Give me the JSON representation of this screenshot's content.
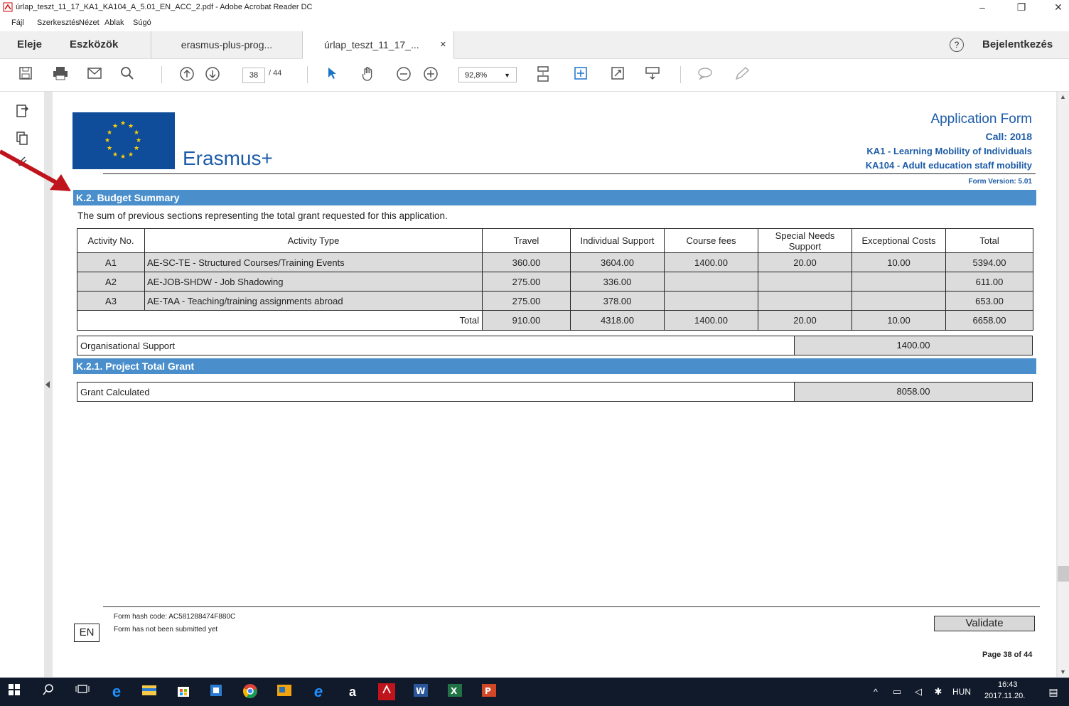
{
  "window": {
    "title": "úrlap_teszt_11_17_KA1_KA104_A_5.01_EN_ACC_2.pdf - Adobe Acrobat Reader DC",
    "minimize": "–",
    "restore": "❐",
    "close": "✕"
  },
  "menu": [
    "Fájl",
    "Szerkesztés",
    "Nézet",
    "Ablak",
    "Súgó"
  ],
  "tabs": {
    "home": "Eleje",
    "tools": "Eszközök",
    "doc1": "erasmus-plus-prog...",
    "doc2": "úrlap_teszt_11_17_...",
    "doc2_close": "✕",
    "help": "?",
    "signin": "Bejelentkezés"
  },
  "toolbar": {
    "page_current": "38",
    "page_total": "/ 44",
    "zoom": "92,8%"
  },
  "form": {
    "logo_text": "Erasmus+",
    "header_title": "Application Form",
    "call": "Call: 2018",
    "ka1": "KA1 - Learning Mobility of Individuals",
    "ka104": "KA104 - Adult education staff mobility",
    "version": "Form Version: 5.01",
    "section_title": "K.2. Budget Summary",
    "section_desc": "The sum of previous sections representing the total grant requested for this application.",
    "table": {
      "headers": [
        "Activity No.",
        "Activity Type",
        "Travel",
        "Individual Support",
        "Course fees",
        "Special Needs Support",
        "Exceptional Costs",
        "Total"
      ],
      "rows": [
        [
          "A1",
          "AE-SC-TE - Structured Courses/Training Events",
          "360.00",
          "3604.00",
          "1400.00",
          "20.00",
          "10.00",
          "5394.00"
        ],
        [
          "A2",
          "AE-JOB-SHDW - Job Shadowing",
          "275.00",
          "336.00",
          "",
          "",
          "",
          "611.00"
        ],
        [
          "A3",
          "AE-TAA - Teaching/training assignments abroad",
          "275.00",
          "378.00",
          "",
          "",
          "",
          "653.00"
        ]
      ],
      "total_label": "Total",
      "totals": [
        "910.00",
        "4318.00",
        "1400.00",
        "20.00",
        "10.00",
        "6658.00"
      ]
    },
    "org_support_label": "Organisational Support",
    "org_support_value": "1400.00",
    "subsection_title": "K.2.1. Project Total Grant",
    "grant_label": "Grant Calculated",
    "grant_value": "8058.00",
    "hash": "Form hash code: AC581288474F880C",
    "submitted": "Form has not been submitted yet",
    "lang": "EN",
    "validate": "Validate",
    "page_info": "Page 38 of 44"
  },
  "taskbar": {
    "lang": "HUN",
    "time": "16:43",
    "date": "2017.11.20."
  },
  "colors": {
    "section_blue": "#4a8fcc",
    "header_blue": "#1d5ca8",
    "eu_blue": "#0f4c9a",
    "annotation_red": "#c0141c"
  }
}
